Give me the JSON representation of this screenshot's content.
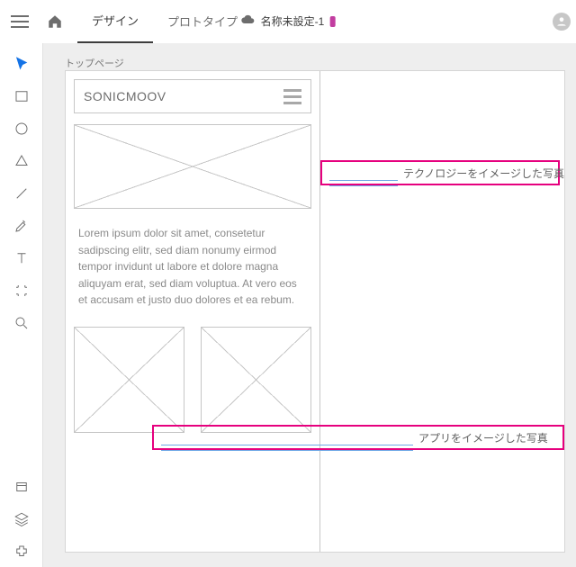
{
  "topbar": {
    "tabs": {
      "design": "デザイン",
      "prototype": "プロトタイプ"
    },
    "document_name": "名称未設定-1"
  },
  "artboard": {
    "label": "トップページ",
    "header_title": "SONICMOOV",
    "body_text": "Lorem ipsum dolor sit amet, consetetur sadipscing elitr, sed diam nonumy eirmod tempor invidunt ut labore et dolore magna aliquyam erat, sed diam voluptua. At vero eos et accusam et justo duo dolores et ea rebum."
  },
  "callouts": {
    "c1": "テクノロジーをイメージした写真",
    "c2": "アプリをイメージした写真"
  }
}
